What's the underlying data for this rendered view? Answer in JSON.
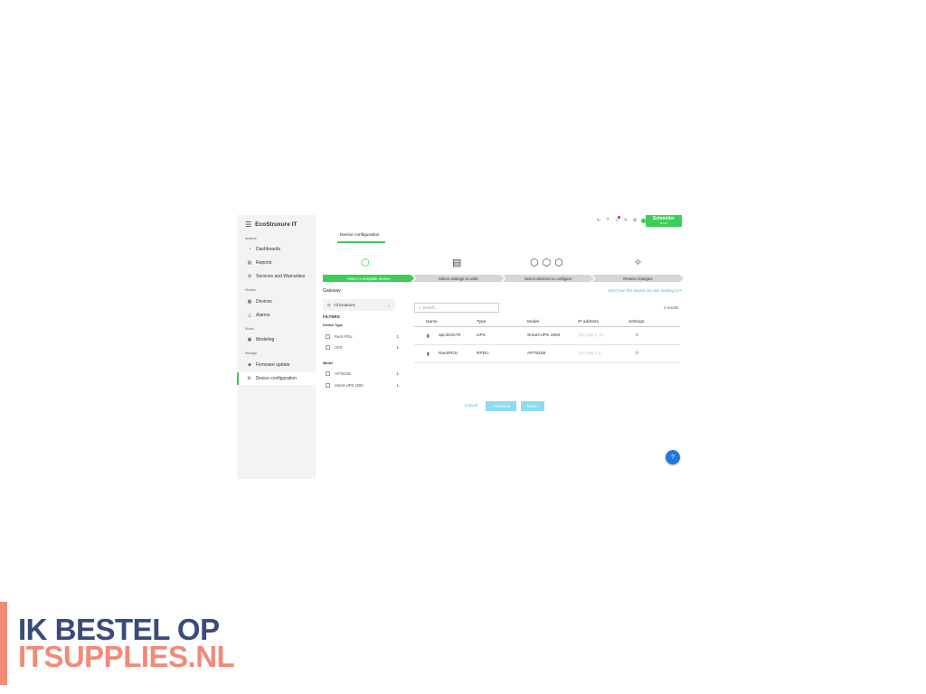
{
  "app": {
    "brand": "EcoStruxure IT",
    "menu_icon": "hamburger-icon"
  },
  "sidebar": {
    "sections": [
      {
        "title": "Analyse",
        "items": [
          {
            "label": "Dashboards",
            "icon": "dashboard-icon"
          },
          {
            "label": "Reports",
            "icon": "report-icon"
          },
          {
            "label": "Services and Warranties",
            "icon": "services-icon"
          }
        ]
      },
      {
        "title": "Monitor",
        "items": [
          {
            "label": "Devices",
            "icon": "devices-icon"
          },
          {
            "label": "Alarms",
            "icon": "alarm-icon"
          }
        ]
      },
      {
        "title": "Model",
        "items": [
          {
            "label": "Modeling",
            "icon": "modeling-icon"
          }
        ]
      },
      {
        "title": "Manage",
        "items": [
          {
            "label": "Firmware update",
            "icon": "firmware-icon"
          },
          {
            "label": "Device configuration",
            "icon": "device-config-icon",
            "active": true
          }
        ]
      }
    ]
  },
  "header": {
    "tab": "Device configuration",
    "logo": "Schneider",
    "logo_sub": "Electric"
  },
  "stepper": {
    "steps": [
      {
        "label": "Select a template device",
        "icon": "template-device-icon",
        "active": true
      },
      {
        "label": "Select settings to write",
        "icon": "document-icon"
      },
      {
        "label": "Select devices to configure",
        "icon": "cubes-icon"
      },
      {
        "label": "Review changes",
        "icon": "magic-wand-icon"
      }
    ]
  },
  "filters_panel": {
    "gateway_label": "Gateway",
    "location": "All locations",
    "filters_title": "FILTERS",
    "groups": [
      {
        "title": "Device Type",
        "options": [
          {
            "label": "Rack PDU",
            "count": "1"
          },
          {
            "label": "UPS",
            "count": "1"
          }
        ]
      },
      {
        "title": "Model",
        "options": [
          {
            "label": "AP7821B",
            "count": "1"
          },
          {
            "label": "Smart-UPS 1500",
            "count": "1"
          }
        ]
      }
    ]
  },
  "help_link": "Don't see the device you are looking for?",
  "table": {
    "search_placeholder": "Search...",
    "results": "2 results",
    "columns": [
      "Name",
      "Type",
      "Model",
      "IP address",
      "Settings"
    ],
    "rows": [
      {
        "name": "apc323A70",
        "type": "UPS",
        "model": "Smart-UPS 1500",
        "ip": "192.168.1.75",
        "settings": "⚙"
      },
      {
        "name": "RackPDU",
        "type": "RPDU",
        "model": "AP7821B",
        "ip": "192.168.1.9",
        "settings": "⚙"
      }
    ]
  },
  "actions": {
    "cancel": "Cancel",
    "previous": "‹ Previous",
    "next": "Next ›"
  },
  "fab_icon": "help-icon",
  "promo": {
    "line1": "IK BESTEL OP",
    "line2": "ITSUPPLIES.NL"
  },
  "colors": {
    "accent_green": "#3dcd58",
    "link_blue": "#42b4e6",
    "promo_navy": "#3a4a7a",
    "promo_salmon": "#f28a78"
  }
}
